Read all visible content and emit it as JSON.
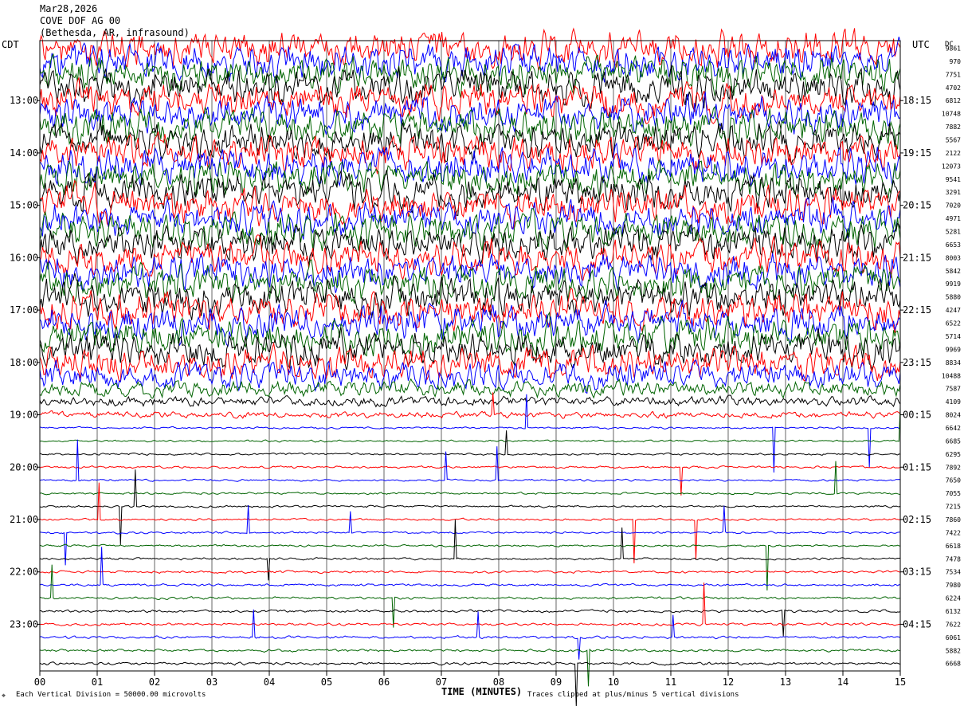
{
  "header": {
    "date": "Mar28,2026",
    "station": "COVE DOF AG 00",
    "location": "(Bethesda, AR, infrasound)"
  },
  "left_tz": "CDT",
  "right_tz": "UTC",
  "dc_label": "DC",
  "footer": {
    "scale": "Each Vertical Division = 50000.00 microvolts",
    "clip": "Traces clipped at plus/minus 5 vertical divisions",
    "corner_mark": "⌖"
  },
  "chart_data": {
    "type": "helicorder",
    "xlabel": "TIME (MINUTES)",
    "x_ticks": [
      "00",
      "01",
      "02",
      "03",
      "04",
      "05",
      "06",
      "07",
      "08",
      "09",
      "10",
      "11",
      "12",
      "13",
      "14",
      "15"
    ],
    "xlim": [
      0,
      15
    ],
    "trace_minutes": 15,
    "trace_colors": [
      "#ff0000",
      "#0000ff",
      "#006400",
      "#000000"
    ],
    "left_hour_labels": [
      "13:00",
      "14:00",
      "15:00",
      "16:00",
      "17:00",
      "18:00",
      "19:00",
      "20:00",
      "21:00",
      "22:00",
      "23:00"
    ],
    "right_hour_labels": [
      "18:15",
      "19:15",
      "20:15",
      "21:15",
      "22:15",
      "23:15",
      "00:15",
      "01:15",
      "02:15",
      "03:15",
      "04:15"
    ],
    "dc_offsets": [
      9861,
      970,
      7751,
      4702,
      6812,
      10748,
      7882,
      5567,
      2122,
      12073,
      9541,
      3291,
      7020,
      4971,
      5281,
      6653,
      8003,
      5842,
      9919,
      5880,
      4247,
      6522,
      5714,
      9969,
      8834,
      10488,
      7587,
      4109,
      8024,
      6642,
      6685,
      6295,
      7892,
      7650,
      7055,
      7215,
      7860,
      7422,
      6618,
      7478,
      7534,
      7980,
      6224,
      6132,
      7622,
      6061,
      5882,
      6668
    ],
    "activity_level": [
      9,
      9,
      9,
      9,
      9,
      9,
      9,
      9,
      9,
      9,
      9,
      9,
      9,
      9,
      9,
      9,
      9,
      9,
      9,
      9,
      9,
      9,
      9,
      9,
      8,
      7,
      4,
      2.5,
      1.6,
      0.5,
      0.5,
      0.5,
      0.6,
      0.5,
      0.55,
      0.55,
      0.55,
      0.55,
      0.55,
      0.6,
      0.6,
      0.6,
      0.6,
      0.65,
      0.65,
      0.65,
      0.65,
      0.7
    ],
    "clip_divisions": 5,
    "vertical_division_microvolts": 50000
  }
}
